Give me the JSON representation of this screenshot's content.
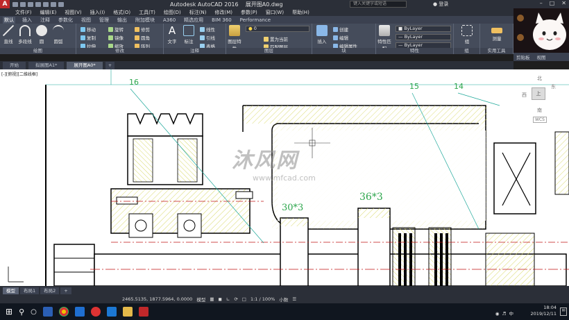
{
  "app": {
    "title": "Autodesk AutoCAD 2016",
    "document": "展开图A0.dwg",
    "search_placeholder": "键入关键字或短语",
    "login_label": "登录"
  },
  "menus": [
    "文件(F)",
    "编辑(E)",
    "视图(V)",
    "插入(I)",
    "格式(O)",
    "工具(T)",
    "绘图(D)",
    "标注(N)",
    "修改(M)",
    "参数(P)",
    "窗口(W)",
    "帮助(H)"
  ],
  "ribbon_tabs": [
    {
      "label": "默认",
      "active": true
    },
    {
      "label": "插入",
      "active": false
    },
    {
      "label": "注释",
      "active": false
    },
    {
      "label": "参数化",
      "active": false
    },
    {
      "label": "视图",
      "active": false
    },
    {
      "label": "管理",
      "active": false
    },
    {
      "label": "输出",
      "active": false
    },
    {
      "label": "附加模块",
      "active": false
    },
    {
      "label": "A360",
      "active": false
    },
    {
      "label": "精选应用",
      "active": false
    },
    {
      "label": "BIM 360",
      "active": false
    },
    {
      "label": "Performance",
      "active": false
    }
  ],
  "ribbon": {
    "draw": {
      "label": "绘图",
      "line": "直线",
      "polyline": "多段线",
      "circle": "圆",
      "arc": "圆弧"
    },
    "modify": {
      "label": "修改",
      "move": "移动",
      "rotate": "旋转",
      "trim": "修剪",
      "copy": "复制",
      "mirror": "镜像",
      "fillet": "圆角",
      "stretch": "拉伸",
      "scale": "缩放",
      "array": "阵列"
    },
    "annotation": {
      "label": "注释",
      "text": "文字",
      "dimension": "标注",
      "linear": "线性",
      "leader": "引线",
      "table": "表格"
    },
    "layers": {
      "label": "图层",
      "properties": "图层特性",
      "current_layer": "0",
      "set_current": "置为当前",
      "match": "匹配图层"
    },
    "block": {
      "label": "块",
      "insert": "插入",
      "create": "创建",
      "edit": "编辑",
      "edit_attrs": "编辑属性"
    },
    "properties": {
      "label": "特性",
      "match": "特性匹配",
      "color": "ByLayer",
      "linetype": "ByLayer",
      "lineweight": "ByLayer"
    },
    "groups": {
      "label": "组",
      "group": "组"
    },
    "utilities": {
      "label": "实用工具",
      "measure": "测量"
    },
    "clipboard": {
      "label": "剪贴板"
    },
    "view": {
      "label": "视图"
    }
  },
  "file_tabs": [
    {
      "label": "开始",
      "active": false
    },
    {
      "label": "拟展图A1*",
      "active": false
    },
    {
      "label": "展开图A0*",
      "active": true
    }
  ],
  "viewport": {
    "label": "[-][俯视][二维线框]",
    "compass": {
      "north": "北",
      "south": "南",
      "east": "东",
      "west": "西",
      "top": "上",
      "wcs": "WCS"
    },
    "annotations": [
      "16",
      "15",
      "14",
      "30*3",
      "36*3"
    ],
    "watermark": {
      "brand": "沐风网",
      "url": "www.mfcad.com"
    }
  },
  "layout_tabs": [
    {
      "label": "模型",
      "active": true
    },
    {
      "label": "布局1",
      "active": false
    },
    {
      "label": "布局2",
      "active": false
    }
  ],
  "status": {
    "coordinates": "2465.5135, 1877.5964, 0.0000",
    "model": "模型",
    "scale": "1:1 / 100%",
    "units": "小数"
  },
  "clock": {
    "time": "18:04",
    "date": "2019/12/11"
  },
  "tray": {
    "lang": "中"
  },
  "colors": {
    "titlebar": "#2b2f38",
    "ribbon": "#454c5b",
    "drawing_line": "#000000",
    "center_line": "#c01414",
    "hatch": "#d9d96a",
    "leader": "#1ea89a",
    "dim_text": "#2aa54a"
  }
}
